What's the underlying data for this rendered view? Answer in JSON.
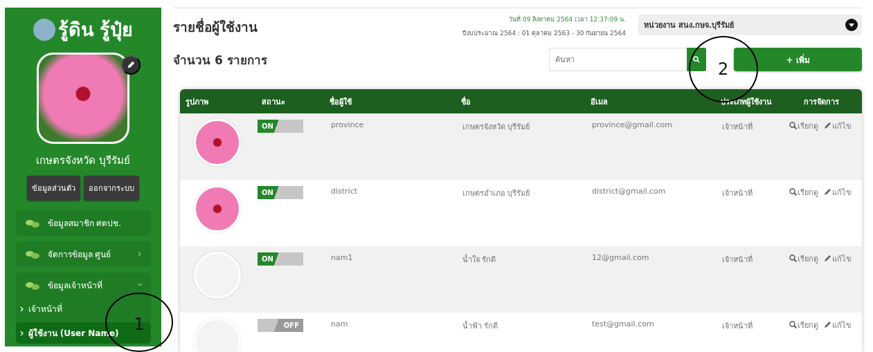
{
  "sidebar": {
    "brand": "รู้ดิน รู้ปุ๋ย",
    "profile_name": "เกษตรจังหวัด บุรีรัมย์",
    "buttons": [
      "ข้อมูลส่วนตัว",
      "ออกจากระบบ"
    ],
    "menu": [
      {
        "label": "ข้อมูลสมาชิก ศดปช.",
        "kind": "link"
      },
      {
        "label": "จัดการข้อมูล ศูนย์",
        "kind": "group",
        "expanded": false
      },
      {
        "label": "ข้อมูลเจ้าหน้าที่",
        "kind": "group",
        "expanded": true,
        "children": [
          {
            "label": "เจ้าหน้าที่",
            "selected": false
          },
          {
            "label": "ผู้ใช้งาน (User Name)",
            "selected": true
          }
        ]
      }
    ]
  },
  "header": {
    "title": "รายชื่อผู้ใช้งาน",
    "date": "วันที่ 09 สิงหาคม 2564 เวลา 12:37:09 น.",
    "fiscal_year": "ปีงบประมาณ 2564 : 01 ตุลาคม 2563 - 30 กันยายน 2564",
    "agency": "หน่วยงาน สนง.กษจ.บุรีรัมย์"
  },
  "toolbar": {
    "count": "จำนวน 6 รายการ",
    "search": {
      "placeholder": "ค้นหา"
    },
    "add_button": "+ เพิ่ม"
  },
  "table": {
    "columns": [
      "รูปภาพ",
      "สถานะ",
      "ชื่อผู้ใช้",
      "ชื่อ",
      "อีเมล",
      "ประเภทผู้ใช้งาน",
      "การจัดการ"
    ],
    "rows": [
      {
        "photo": true,
        "on": true,
        "toggle_label": "ON",
        "username": "province",
        "name": "เกษตรจังหวัด บุรีรัมย์",
        "email": "province@gmail.com",
        "type": "เจ้าหน้าที่",
        "view": "เรียกดู",
        "edit": "แก้ไข"
      },
      {
        "photo": true,
        "on": true,
        "toggle_label": "ON",
        "username": "district",
        "name": "เกษตรอำเภอ บุรีรัมย์",
        "email": "district@gmail.com",
        "type": "เจ้าหน้าที่",
        "view": "เรียกดู",
        "edit": "แก้ไข"
      },
      {
        "photo": false,
        "on": true,
        "toggle_label": "ON",
        "username": "nam1",
        "name": "น้ำใจ รักดี",
        "email": "12@gmail.com",
        "type": "เจ้าหน้าที่",
        "view": "เรียกดู",
        "edit": "แก้ไข"
      },
      {
        "photo": false,
        "on": false,
        "toggle_label": "OFF",
        "username": "nam",
        "name": "น้ำฟ้า รักดี",
        "email": "test@gmail.com",
        "type": "เจ้าหน้าที่",
        "view": "เรียกดู",
        "edit": "แก้ไข"
      }
    ]
  },
  "annotations": [
    {
      "label": "1"
    },
    {
      "label": "2"
    }
  ]
}
